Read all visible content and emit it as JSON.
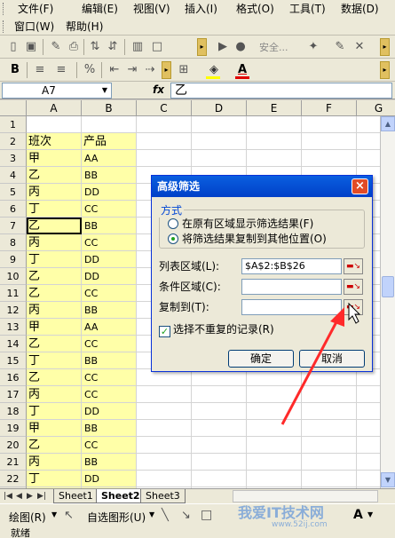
{
  "menu": {
    "row1": [
      "文件(F)",
      "编辑(E)",
      "视图(V)",
      "插入(I)",
      "格式(O)",
      "工具(T)",
      "数据(D)"
    ],
    "row2": [
      "窗口(W)",
      "帮助(H)"
    ]
  },
  "toolbar": {
    "security_label": "安全..."
  },
  "formula_bar": {
    "name_box": "A7",
    "fx": "fx",
    "content": "乙"
  },
  "columns": [
    "A",
    "B",
    "C",
    "D",
    "E",
    "F",
    "G"
  ],
  "rows": [
    {
      "n": "1",
      "a": "",
      "b": ""
    },
    {
      "n": "2",
      "a": "班次",
      "b": "产品"
    },
    {
      "n": "3",
      "a": "甲",
      "b": "AA"
    },
    {
      "n": "4",
      "a": "乙",
      "b": "BB"
    },
    {
      "n": "5",
      "a": "丙",
      "b": "DD"
    },
    {
      "n": "6",
      "a": "丁",
      "b": "CC"
    },
    {
      "n": "7",
      "a": "乙",
      "b": "BB"
    },
    {
      "n": "8",
      "a": "丙",
      "b": "CC"
    },
    {
      "n": "9",
      "a": "丁",
      "b": "DD"
    },
    {
      "n": "10",
      "a": "乙",
      "b": "DD"
    },
    {
      "n": "11",
      "a": "乙",
      "b": "CC"
    },
    {
      "n": "12",
      "a": "丙",
      "b": "BB"
    },
    {
      "n": "13",
      "a": "甲",
      "b": "AA"
    },
    {
      "n": "14",
      "a": "乙",
      "b": "CC"
    },
    {
      "n": "15",
      "a": "丁",
      "b": "BB"
    },
    {
      "n": "16",
      "a": "乙",
      "b": "CC"
    },
    {
      "n": "17",
      "a": "丙",
      "b": "CC"
    },
    {
      "n": "18",
      "a": "丁",
      "b": "DD"
    },
    {
      "n": "19",
      "a": "甲",
      "b": "BB"
    },
    {
      "n": "20",
      "a": "乙",
      "b": "CC"
    },
    {
      "n": "21",
      "a": "丙",
      "b": "BB"
    },
    {
      "n": "22",
      "a": "丁",
      "b": "DD"
    },
    {
      "n": "23",
      "a": "甲",
      "b": "CC"
    },
    {
      "n": "24",
      "a": "乙",
      "b": "CC"
    },
    {
      "n": "25",
      "a": "丁",
      "b": "BB"
    },
    {
      "n": "26",
      "a": "乙",
      "b": "DD"
    }
  ],
  "selected_cell": "A7",
  "sheets": [
    "Sheet1",
    "Sheet2",
    "Sheet3"
  ],
  "active_sheet": "Sheet2",
  "drawbar": {
    "draw_label": "绘图(R)",
    "autoshape_label": "自选图形(U)"
  },
  "status": "就绪",
  "dialog": {
    "title": "高级筛选",
    "close": "×",
    "mode_label": "方式",
    "option1": "在原有区域显示筛选结果(F)",
    "option2": "将筛选结果复制到其他位置(O)",
    "list_range_label": "列表区域(L):",
    "list_range_value": "$A$2:$B$26",
    "criteria_label": "条件区域(C):",
    "criteria_value": "",
    "copy_to_label": "复制到(T):",
    "copy_to_value": "",
    "unique_label": "选择不重复的记录(R)",
    "ok": "确定",
    "cancel": "取消"
  },
  "watermark": {
    "text": "我爱IT技术网",
    "url": "www.52ij.com"
  },
  "colors": {
    "highlight": "#ffffa8",
    "arrow": "#ff2a2a",
    "title_bar": "#0a5fe0"
  }
}
